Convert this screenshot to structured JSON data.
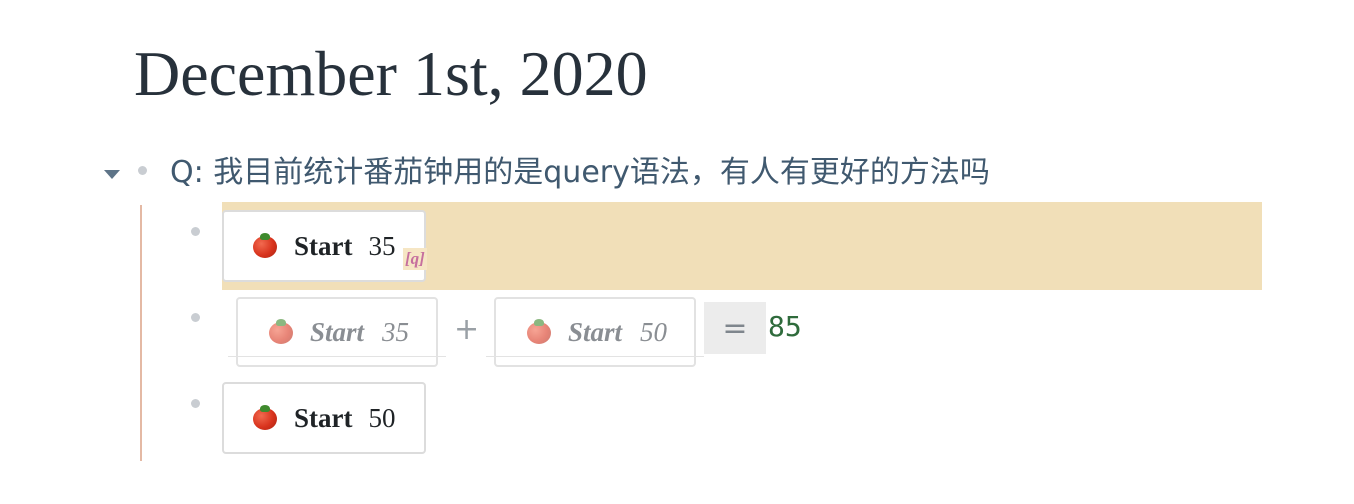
{
  "page": {
    "title": "December 1st, 2020"
  },
  "question_block": {
    "text": "Q: 我目前统计番茄钟用的是query语法，有人有更好的方法吗"
  },
  "children": [
    {
      "timer": {
        "icon": "tomato-icon",
        "label": "Start",
        "minutes": "35"
      },
      "ref_tag": "[q]",
      "highlighted": true
    },
    {
      "embed_a": {
        "icon": "tomato-icon",
        "label": "Start",
        "minutes": "35"
      },
      "operator": "+",
      "embed_b": {
        "icon": "tomato-icon",
        "label": "Start",
        "minutes": "50"
      },
      "equals": "=",
      "result": "85"
    },
    {
      "timer": {
        "icon": "tomato-icon",
        "label": "Start",
        "minutes": "50"
      }
    }
  ],
  "colors": {
    "highlight_bg": "#f1dfb8",
    "thread_line": "#e4b9a4",
    "question_text": "#40596f",
    "result_text": "#2f6b3c",
    "ref_tag": "#c66f9e"
  }
}
